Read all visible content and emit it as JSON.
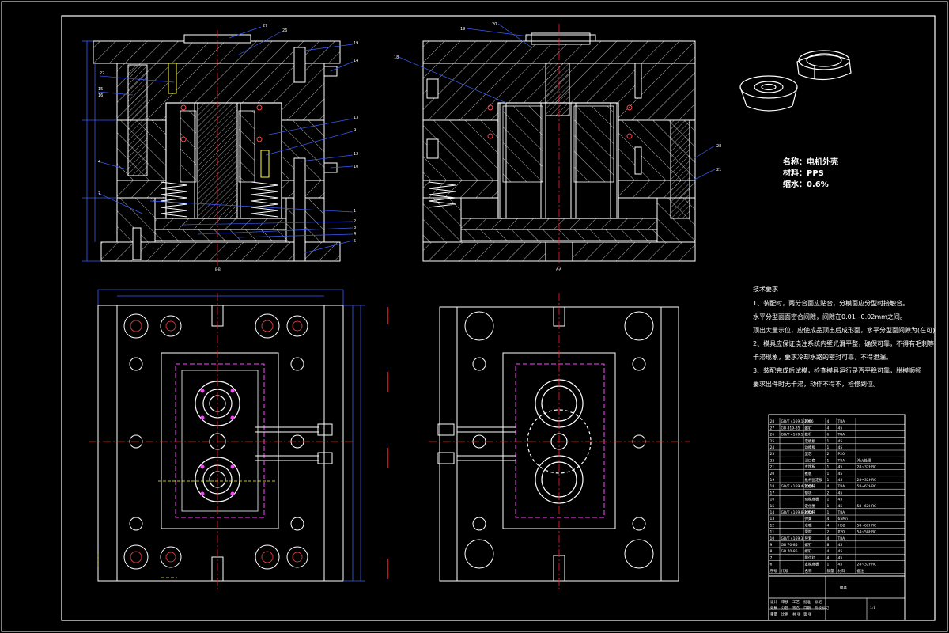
{
  "part_info": {
    "name": "名称：电机外壳",
    "material": "材料：PPS",
    "shrinkage": "缩水：0.6%"
  },
  "tech_requirements": {
    "title": "技术要求",
    "lines": [
      "1、装配时，两分合面应贴合，分模面应分型时接触合。",
      "水平分型面面密合间隙，间隙在0.01~0.02mm之间。",
      "顶出大量示位，应使成品顶出后成形面，水平分型面间隙为(在可)",
      "2、模具应保证浇注系统内壁光滑平整，确保可靠，不得有毛刺等",
      "卡滞现象，要求冷却水路的密封可靠，不得泄漏。",
      "3、装配完成后试模，检查模具运行是否平稳可靠，脱模顺畅",
      "要求出件时无卡滞，动作不得不，检修到位。"
    ]
  },
  "view_labels": {
    "section_left": "B-B",
    "section_right": "A-A"
  },
  "title_block": {
    "drawing_title": "模具",
    "col_headers": [
      "序号",
      "代号",
      "名称",
      "数量",
      "材料",
      "备注"
    ],
    "rows": [
      [
        "28",
        "GB/T 4169.1-2006",
        "导柱",
        "4",
        "T8A",
        ""
      ],
      [
        "27",
        "GB 819-85",
        "螺钉",
        "4",
        "45",
        ""
      ],
      [
        "26",
        "GB/T 4169.1",
        "推杆",
        "6",
        "T8A",
        ""
      ],
      [
        "25",
        "",
        "定模板",
        "1",
        "45",
        ""
      ],
      [
        "24",
        "",
        "动模板",
        "1",
        "45",
        ""
      ],
      [
        "23",
        "",
        "型芯",
        "2",
        "P20",
        ""
      ],
      [
        "22",
        "",
        "浇口套",
        "1",
        "T8A",
        "淬火处理"
      ],
      [
        "21",
        "",
        "支撑板",
        "1",
        "45",
        "28~32HRC"
      ],
      [
        "20",
        "",
        "推板",
        "1",
        "45",
        ""
      ],
      [
        "19",
        "",
        "推杆固定板",
        "1",
        "45",
        "28~32HRC"
      ],
      [
        "18",
        "GB/T 4169.4-2006",
        "复位杆",
        "4",
        "T8A",
        "58~62HRC"
      ],
      [
        "17",
        "",
        "垫块",
        "2",
        "45",
        ""
      ],
      [
        "16",
        "",
        "动模座板",
        "1",
        "45",
        ""
      ],
      [
        "15",
        "",
        "定位圈",
        "1",
        "45",
        "58~62HRC"
      ],
      [
        "14",
        "GB/T 4169.8-2006",
        "拉料杆",
        "1",
        "T8A",
        ""
      ],
      [
        "13",
        "",
        "弹簧",
        "4",
        "65Mn",
        ""
      ],
      [
        "12",
        "",
        "水嘴",
        "4",
        "H62",
        "58~62HRC"
      ],
      [
        "11",
        "",
        "型腔",
        "2",
        "P20",
        "54~58HRC"
      ],
      [
        "10",
        "GB/T 4169.3",
        "导套",
        "4",
        "T8A",
        ""
      ],
      [
        "9",
        "GB 70-85",
        "螺钉",
        "8",
        "45",
        ""
      ],
      [
        "8",
        "GB 70-85",
        "螺钉",
        "4",
        "45",
        ""
      ],
      [
        "7",
        "",
        "限位钉",
        "4",
        "45",
        ""
      ],
      [
        "6",
        "",
        "定模座板",
        "1",
        "45",
        "28~32HRC"
      ]
    ],
    "bottom_labels": [
      "设计",
      "审核",
      "工艺",
      "批准",
      "标记",
      "处数",
      "分区",
      "签名",
      "日期",
      "阶段标记",
      "重量",
      "比例",
      "共  张",
      "第  张"
    ],
    "scale": "1:1"
  },
  "part_numbers": {
    "left_side": [
      "1",
      "2",
      "3",
      "4",
      "5",
      "6",
      "7",
      "8"
    ],
    "right_side": [
      "9",
      "10",
      "11",
      "12",
      "13",
      "14",
      "15",
      "16",
      "17",
      "18"
    ],
    "top": [
      "27",
      "26",
      "19",
      "20",
      "21"
    ]
  },
  "colors": {
    "background": "#000000",
    "outline": "#ffffff",
    "hatch": "#ffffff",
    "centerline": "#ff2020",
    "dimension": "#3a5cff",
    "leader": "#3a5cff",
    "cooling": "#ff44ff",
    "green": "#33dd33",
    "yellow": "#ffff33"
  }
}
